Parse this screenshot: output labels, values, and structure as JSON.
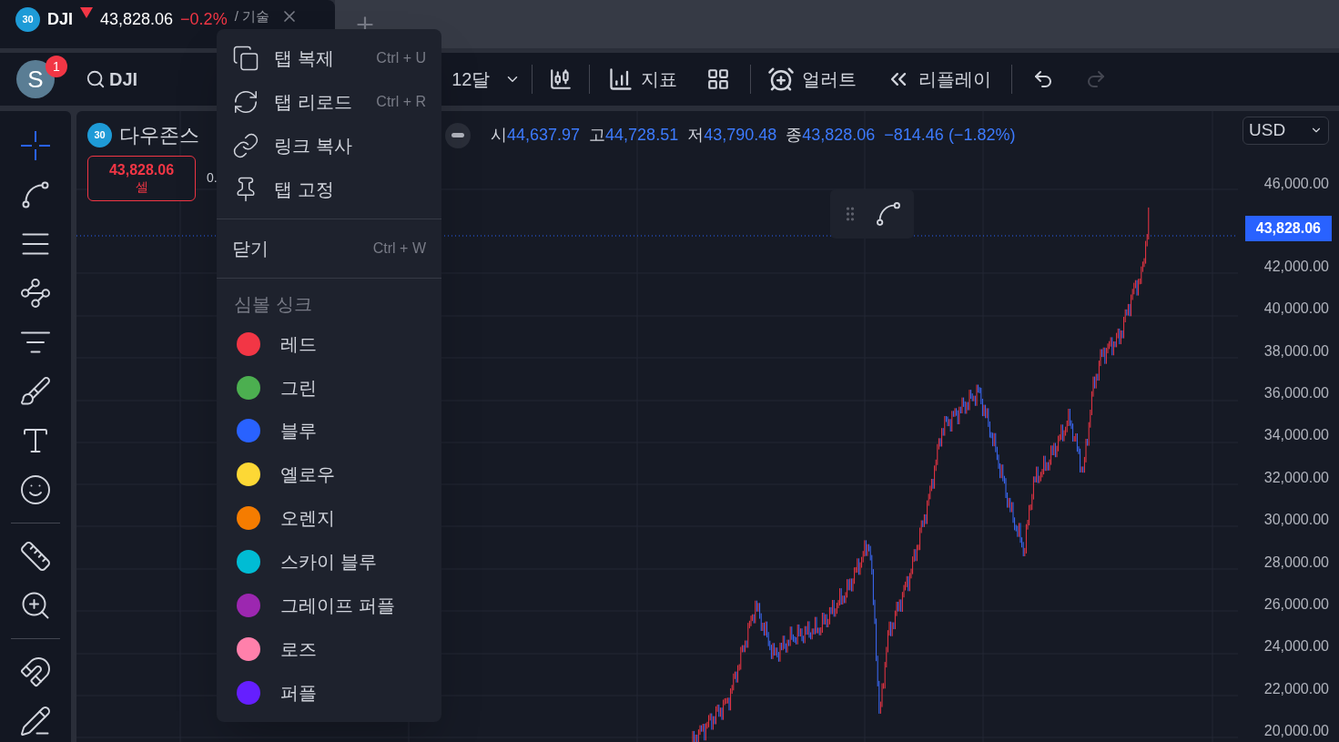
{
  "tab": {
    "badge": "30",
    "symbol": "DJI",
    "price": "43,828.06",
    "change": "−0.2%",
    "extra": "/ 기술"
  },
  "toolbar": {
    "avatar": "S",
    "notifications": "1",
    "search": "DJI",
    "interval": "12달",
    "indicators": "지표",
    "alert": "얼러트",
    "replay": "리플레이",
    "redo_disabled": true
  },
  "legend": {
    "badge": "30",
    "name": "다우존스",
    "ohlc": [
      {
        "label": "시",
        "value": "44,637.97"
      },
      {
        "label": "고",
        "value": "44,728.51"
      },
      {
        "label": "저",
        "value": "43,790.48"
      },
      {
        "label": "종",
        "value": "43,828.06"
      }
    ],
    "change": "−814.46 (−1.82%)",
    "sell_price": "43,828.06",
    "sell_label": "셀",
    "spread": "0."
  },
  "price_axis": {
    "currency": "USD",
    "ticks_above": [
      "46,000.00"
    ],
    "current": "43,828.06",
    "ticks_below": [
      "42,000.00",
      "40,000.00",
      "38,000.00",
      "36,000.00",
      "34,000.00",
      "32,000.00",
      "30,000.00",
      "28,000.00",
      "26,000.00",
      "24,000.00",
      "22,000.00",
      "20,000.00"
    ]
  },
  "menu": {
    "items": [
      {
        "label": "탭 복제",
        "shortcut": "Ctrl + U"
      },
      {
        "label": "탭 리로드",
        "shortcut": "Ctrl + R"
      },
      {
        "label": "링크 복사"
      },
      {
        "label": "탭 고정"
      }
    ],
    "close": {
      "label": "닫기",
      "shortcut": "Ctrl + W"
    },
    "sync_title": "심볼 싱크",
    "colors": [
      {
        "label": "레드",
        "color": "#f23645"
      },
      {
        "label": "그린",
        "color": "#4caf50"
      },
      {
        "label": "블루",
        "color": "#2962ff"
      },
      {
        "label": "옐로우",
        "color": "#fdd835"
      },
      {
        "label": "오렌지",
        "color": "#f57c00"
      },
      {
        "label": "스카이 블루",
        "color": "#00bcd4"
      },
      {
        "label": "그레이프 퍼플",
        "color": "#9c27b0"
      },
      {
        "label": "로즈",
        "color": "#ff80ab"
      },
      {
        "label": "퍼플",
        "color": "#651fff"
      }
    ]
  }
}
